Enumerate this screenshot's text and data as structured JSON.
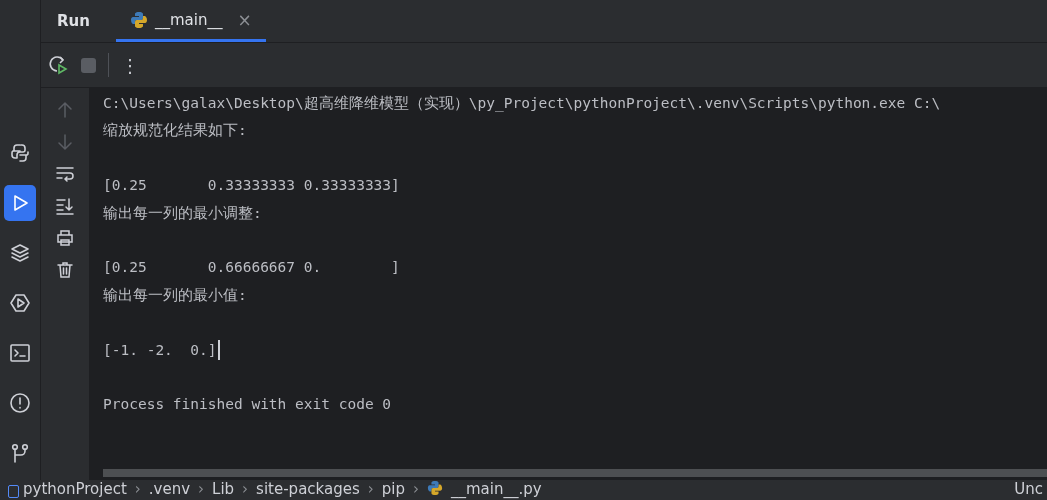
{
  "sidebar": {
    "items": [
      {
        "kind": "python",
        "selected": false
      },
      {
        "kind": "run",
        "selected": true
      },
      {
        "kind": "layers",
        "selected": false
      },
      {
        "kind": "services",
        "selected": false
      },
      {
        "kind": "terminal",
        "selected": false
      },
      {
        "kind": "problems",
        "selected": false
      },
      {
        "kind": "git",
        "selected": false
      }
    ]
  },
  "panel": {
    "title": "Run",
    "tabs": [
      {
        "label": "__main__",
        "selected": true,
        "close": "×"
      }
    ]
  },
  "toolbar": {
    "more": "⋮",
    "stop_disabled": true
  },
  "console_tools": [
    {
      "kind": "up",
      "disabled": true
    },
    {
      "kind": "down",
      "disabled": true
    },
    {
      "kind": "wrap",
      "disabled": false
    },
    {
      "kind": "scroll-end",
      "disabled": false
    },
    {
      "kind": "print",
      "disabled": false
    },
    {
      "kind": "trash",
      "disabled": false
    }
  ],
  "console": {
    "lines": [
      {
        "kind": "text",
        "text": "C:\\Users\\galax\\Desktop\\超高维降维模型（实现）\\py_Project\\pythonProject\\.venv\\Scripts\\python.exe C:\\",
        "cursor": false
      },
      {
        "kind": "text",
        "text": "缩放规范化结果如下:",
        "cursor": false
      },
      {
        "kind": "blank"
      },
      {
        "kind": "text",
        "text": "[0.25       0.33333333 0.33333333]",
        "cursor": false
      },
      {
        "kind": "text",
        "text": "输出每一列的最小调整:",
        "cursor": false
      },
      {
        "kind": "blank"
      },
      {
        "kind": "text",
        "text": "[0.25       0.66666667 0.        ]",
        "cursor": false
      },
      {
        "kind": "text",
        "text": "输出每一列的最小值:",
        "cursor": false
      },
      {
        "kind": "blank"
      },
      {
        "kind": "text",
        "text": "[-1. -2.  0.]",
        "cursor": true
      },
      {
        "kind": "blank"
      },
      {
        "kind": "text",
        "text": "Process finished with exit code 0",
        "cursor": false
      }
    ]
  },
  "breadcrumbs": [
    {
      "label": "pythonProject",
      "kind": "folder"
    },
    {
      "sep": "›",
      "label": ".venv",
      "kind": "plain"
    },
    {
      "sep": "›",
      "label": "Lib",
      "kind": "plain"
    },
    {
      "sep": "›",
      "label": "site-packages",
      "kind": "plain"
    },
    {
      "sep": "›",
      "label": "pip",
      "kind": "plain"
    },
    {
      "sep": "›",
      "label": "__main__.py",
      "kind": "python"
    }
  ],
  "status_right": "Unc"
}
